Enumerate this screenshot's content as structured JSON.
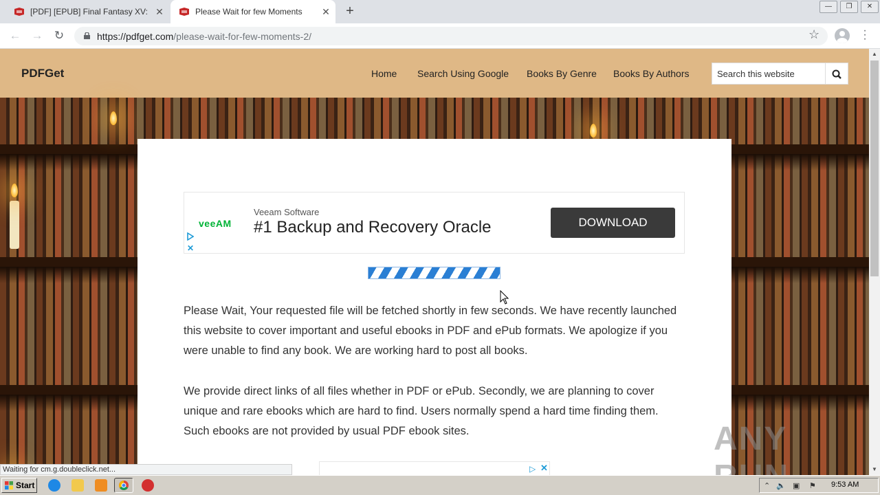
{
  "browser": {
    "tabs": [
      {
        "title": "[PDF] [EPUB] Final Fantasy XV: The Dawn of the Future Download",
        "active": false
      },
      {
        "title": "Please Wait for few Moments",
        "active": true
      }
    ],
    "new_tab": "+",
    "window_buttons": {
      "minimize": "—",
      "maximize": "❐",
      "close": "✕"
    },
    "url_host": "https://pdfget.com",
    "url_path": "/please-wait-for-few-moments-2/",
    "status_text": "Waiting for cm.g.doubleclick.net..."
  },
  "site": {
    "logo": "PDFGet",
    "nav": [
      "Home",
      "Search Using Google",
      "Books By Genre",
      "Books By Authors"
    ],
    "search_placeholder": "Search this website"
  },
  "ad": {
    "logo": "veeAM",
    "advertiser": "Veeam Software",
    "headline": "#1 Backup and Recovery Oracle",
    "cta": "DOWNLOAD"
  },
  "content": {
    "paragraph1": "Please Wait, Your requested file will be fetched shortly in few seconds. We have recently launched this website to cover important and useful ebooks in PDF and ePub formats. We apologize if you were unable to find any book. We are working hard to post all books.",
    "paragraph2": "We provide direct links of all files whether in PDF or ePub. Secondly, we are planning to cover unique and rare ebooks which are hard to find. Users normally spend a hard time finding them. Such ebooks are not provided by usual PDF ebook sites."
  },
  "watermark": "ANY RUN",
  "taskbar": {
    "start_label": "Start",
    "clock": "9:53 AM"
  },
  "colors": {
    "header_bg": "#dfb886",
    "ad_cta_bg": "#3a3a3a",
    "ad_logo": "#00b336",
    "adchoices": "#1e9bd7"
  }
}
